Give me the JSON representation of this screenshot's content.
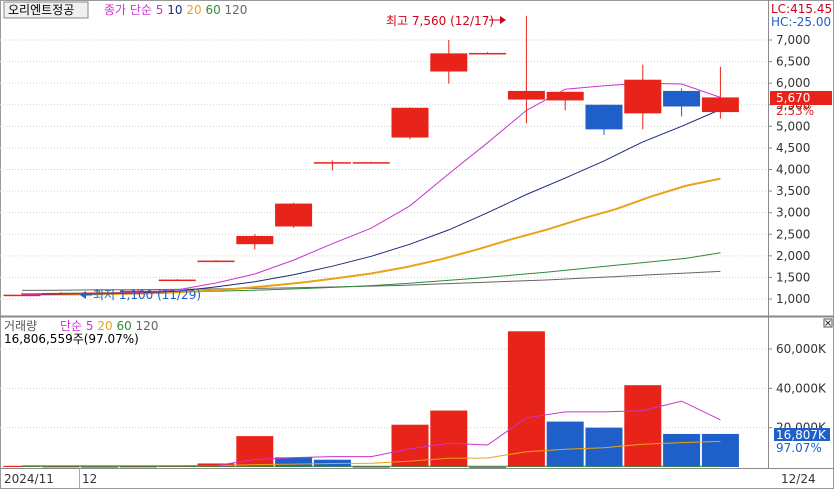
{
  "price_panel": {
    "legend_title": "오리엔트정공",
    "ma_legend": {
      "prefix": "종가 단순",
      "periods": [
        {
          "label": "5",
          "color": "#cc33cc"
        },
        {
          "label": "10",
          "color": "#1a2a7a"
        },
        {
          "label": "20",
          "color": "#e8a317"
        },
        {
          "label": "60",
          "color": "#2e8b3e"
        },
        {
          "label": "120",
          "color": "#666666"
        }
      ]
    },
    "lc_label": "LC:415.45",
    "hc_label": "HC:-25.00",
    "high_annotation": "최고 7,560 (12/17)",
    "low_annotation": "최저 1,100 (11/29)",
    "current_price_label": "5,670",
    "change_pct_label": "2.53%",
    "y_ticks": [
      "1,000",
      "1,500",
      "2,000",
      "2,500",
      "3,000",
      "3,500",
      "4,000",
      "4,500",
      "5,000",
      "5,500",
      "6,000",
      "6,500",
      "7,000"
    ]
  },
  "volume_panel": {
    "legend_title": "거래량",
    "ma_legend": {
      "prefix": "단순",
      "periods": [
        {
          "label": "5",
          "color": "#cc33cc"
        },
        {
          "label": "20",
          "color": "#e8a317"
        },
        {
          "label": "60",
          "color": "#2e8b3e"
        },
        {
          "label": "120",
          "color": "#666666"
        }
      ]
    },
    "volume_summary": "16,806,559주(97.07%)",
    "current_volume_label": "16,807K",
    "volume_pct_label": "97.07%",
    "y_ticks": [
      "20,000K",
      "40,000K",
      "60,000K"
    ]
  },
  "x_axis": {
    "labels": [
      "2024/11",
      "12",
      "12/24"
    ]
  },
  "colors": {
    "up": "#e8231a",
    "down": "#1f5fc8",
    "axis_text": "#333333",
    "grid": "#d0d0d0",
    "lc_color": "#d0021b",
    "hc_color": "#1f5fc8"
  },
  "chart_data": {
    "type": "candlestick",
    "unit": "KRW",
    "ylim": [
      800,
      7900
    ],
    "volume_ylim": [
      0,
      70000
    ],
    "candles": [
      {
        "open": 1100,
        "high": 1150,
        "low": 1100,
        "close": 1100,
        "dir": "flat"
      },
      {
        "open": 1140,
        "high": 1160,
        "low": 1120,
        "close": 1140,
        "dir": "flat"
      },
      {
        "open": 1150,
        "high": 1170,
        "low": 1130,
        "close": 1150,
        "dir": "flat"
      },
      {
        "open": 1190,
        "high": 1220,
        "low": 1170,
        "close": 1190,
        "dir": "flat"
      },
      {
        "open": 1450,
        "high": 1460,
        "low": 1440,
        "close": 1450,
        "dir": "flat"
      },
      {
        "open": 1890,
        "high": 1900,
        "low": 1880,
        "close": 1890,
        "dir": "flat"
      },
      {
        "open": 2270,
        "high": 2500,
        "low": 2150,
        "close": 2460,
        "dir": "up"
      },
      {
        "open": 2680,
        "high": 3230,
        "low": 2650,
        "close": 3210,
        "dir": "up"
      },
      {
        "open": 4170,
        "high": 4210,
        "low": 3980,
        "close": 4170,
        "dir": "flat"
      },
      {
        "open": 4170,
        "high": 4180,
        "low": 4160,
        "close": 4170,
        "dir": "flat"
      },
      {
        "open": 4740,
        "high": 5440,
        "low": 4700,
        "close": 5430,
        "dir": "up"
      },
      {
        "open": 6270,
        "high": 7000,
        "low": 5990,
        "close": 6690,
        "dir": "up"
      },
      {
        "open": 6700,
        "high": 6720,
        "low": 6680,
        "close": 6700,
        "dir": "flat"
      },
      {
        "open": 5620,
        "high": 7560,
        "low": 5070,
        "close": 5820,
        "dir": "up"
      },
      {
        "open": 5600,
        "high": 5800,
        "low": 5370,
        "close": 5800,
        "dir": "up"
      },
      {
        "open": 5500,
        "high": 5500,
        "low": 4800,
        "close": 4930,
        "dir": "down"
      },
      {
        "open": 5300,
        "high": 6430,
        "low": 4930,
        "close": 6080,
        "dir": "up"
      },
      {
        "open": 5820,
        "high": 5880,
        "low": 5230,
        "close": 5460,
        "dir": "down"
      },
      {
        "open": 5330,
        "high": 6380,
        "low": 5180,
        "close": 5670,
        "dir": "up"
      }
    ],
    "ma5": [
      1100,
      1120,
      1130,
      1150,
      1210,
      1370,
      1580,
      1900,
      2280,
      2640,
      3160,
      3900,
      4620,
      5370,
      5860,
      5940,
      6000,
      5980,
      5670
    ],
    "ma10": [
      1100,
      1110,
      1120,
      1140,
      1180,
      1280,
      1400,
      1560,
      1760,
      1990,
      2270,
      2600,
      3000,
      3420,
      3800,
      4200,
      4640,
      5000,
      5390
    ],
    "ma20": [
      1100,
      1105,
      1110,
      1120,
      1140,
      1180,
      1230,
      1300,
      1380,
      1480,
      1590,
      1740,
      1920,
      2140,
      2380,
      2600,
      2850,
      3080,
      3370,
      3620,
      3790
    ],
    "ma60": [
      1120,
      1130,
      1140,
      1150,
      1160,
      1170,
      1190,
      1210,
      1240,
      1270,
      1310,
      1360,
      1420,
      1480,
      1550,
      1620,
      1700,
      1780,
      1860,
      1940,
      2070
    ],
    "ma120": [
      1200,
      1205,
      1210,
      1215,
      1220,
      1230,
      1240,
      1250,
      1265,
      1280,
      1300,
      1320,
      1350,
      1380,
      1410,
      1440,
      1480,
      1520,
      1560,
      1600,
      1640
    ],
    "volumes": [
      {
        "v": 600,
        "dir": "up"
      },
      {
        "v": 300,
        "dir": "up"
      },
      {
        "v": 200,
        "dir": "up"
      },
      {
        "v": 300,
        "dir": "up"
      },
      {
        "v": 500,
        "dir": "up"
      },
      {
        "v": 1800,
        "dir": "up"
      },
      {
        "v": 15700,
        "dir": "up"
      },
      {
        "v": 4900,
        "dir": "down"
      },
      {
        "v": 3700,
        "dir": "down"
      },
      {
        "v": 200,
        "dir": "up"
      },
      {
        "v": 21500,
        "dir": "up"
      },
      {
        "v": 28700,
        "dir": "up"
      },
      {
        "v": 100,
        "dir": "up"
      },
      {
        "v": 69000,
        "dir": "up"
      },
      {
        "v": 23100,
        "dir": "down"
      },
      {
        "v": 20000,
        "dir": "down"
      },
      {
        "v": 41600,
        "dir": "up"
      },
      {
        "v": 16800,
        "dir": "down"
      },
      {
        "v": 16807,
        "dir": "down"
      }
    ],
    "vol_ma5": [
      500,
      500,
      500,
      500,
      500,
      700,
      3800,
      4800,
      5300,
      5300,
      9200,
      12100,
      11200,
      25000,
      28000,
      28000,
      28700,
      33500,
      24000
    ],
    "vol_ma20": [
      600,
      600,
      600,
      600,
      600,
      650,
      1200,
      1500,
      1800,
      1900,
      3000,
      4400,
      4600,
      7800,
      9000,
      9800,
      11600,
      12400,
      13000
    ]
  }
}
